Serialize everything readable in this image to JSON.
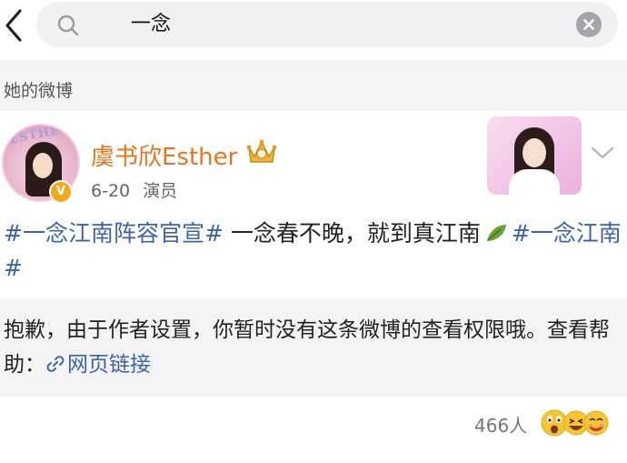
{
  "search": {
    "query": "一念"
  },
  "section": {
    "label": "她的微博"
  },
  "post": {
    "user_name": "虞书欣Esther",
    "date": "6-20",
    "role": "演员",
    "avatar_ring_text": "ESTHER",
    "verified_mark": "V",
    "text": {
      "tag1": "#一念江南阵容官宣#",
      "body": " 一念春不晚，就到真江南",
      "tag2": "#一念江南#"
    },
    "notice": {
      "text": "抱歉，由于作者设置，你暂时没有这条微博的查看权限哦。查看帮助：",
      "link": "网页链接"
    },
    "reaction_count": "466人"
  },
  "colors": {
    "accent_name": "#e8741b",
    "tag_blue": "#3c63a8",
    "section_bg": "#f4f4f6"
  },
  "icons": [
    "back-arrow-icon",
    "search-icon",
    "clear-icon",
    "crown-badge-icon",
    "chevron-down-icon",
    "leaf-icon",
    "link-icon",
    "emoji-reactions-icon"
  ]
}
